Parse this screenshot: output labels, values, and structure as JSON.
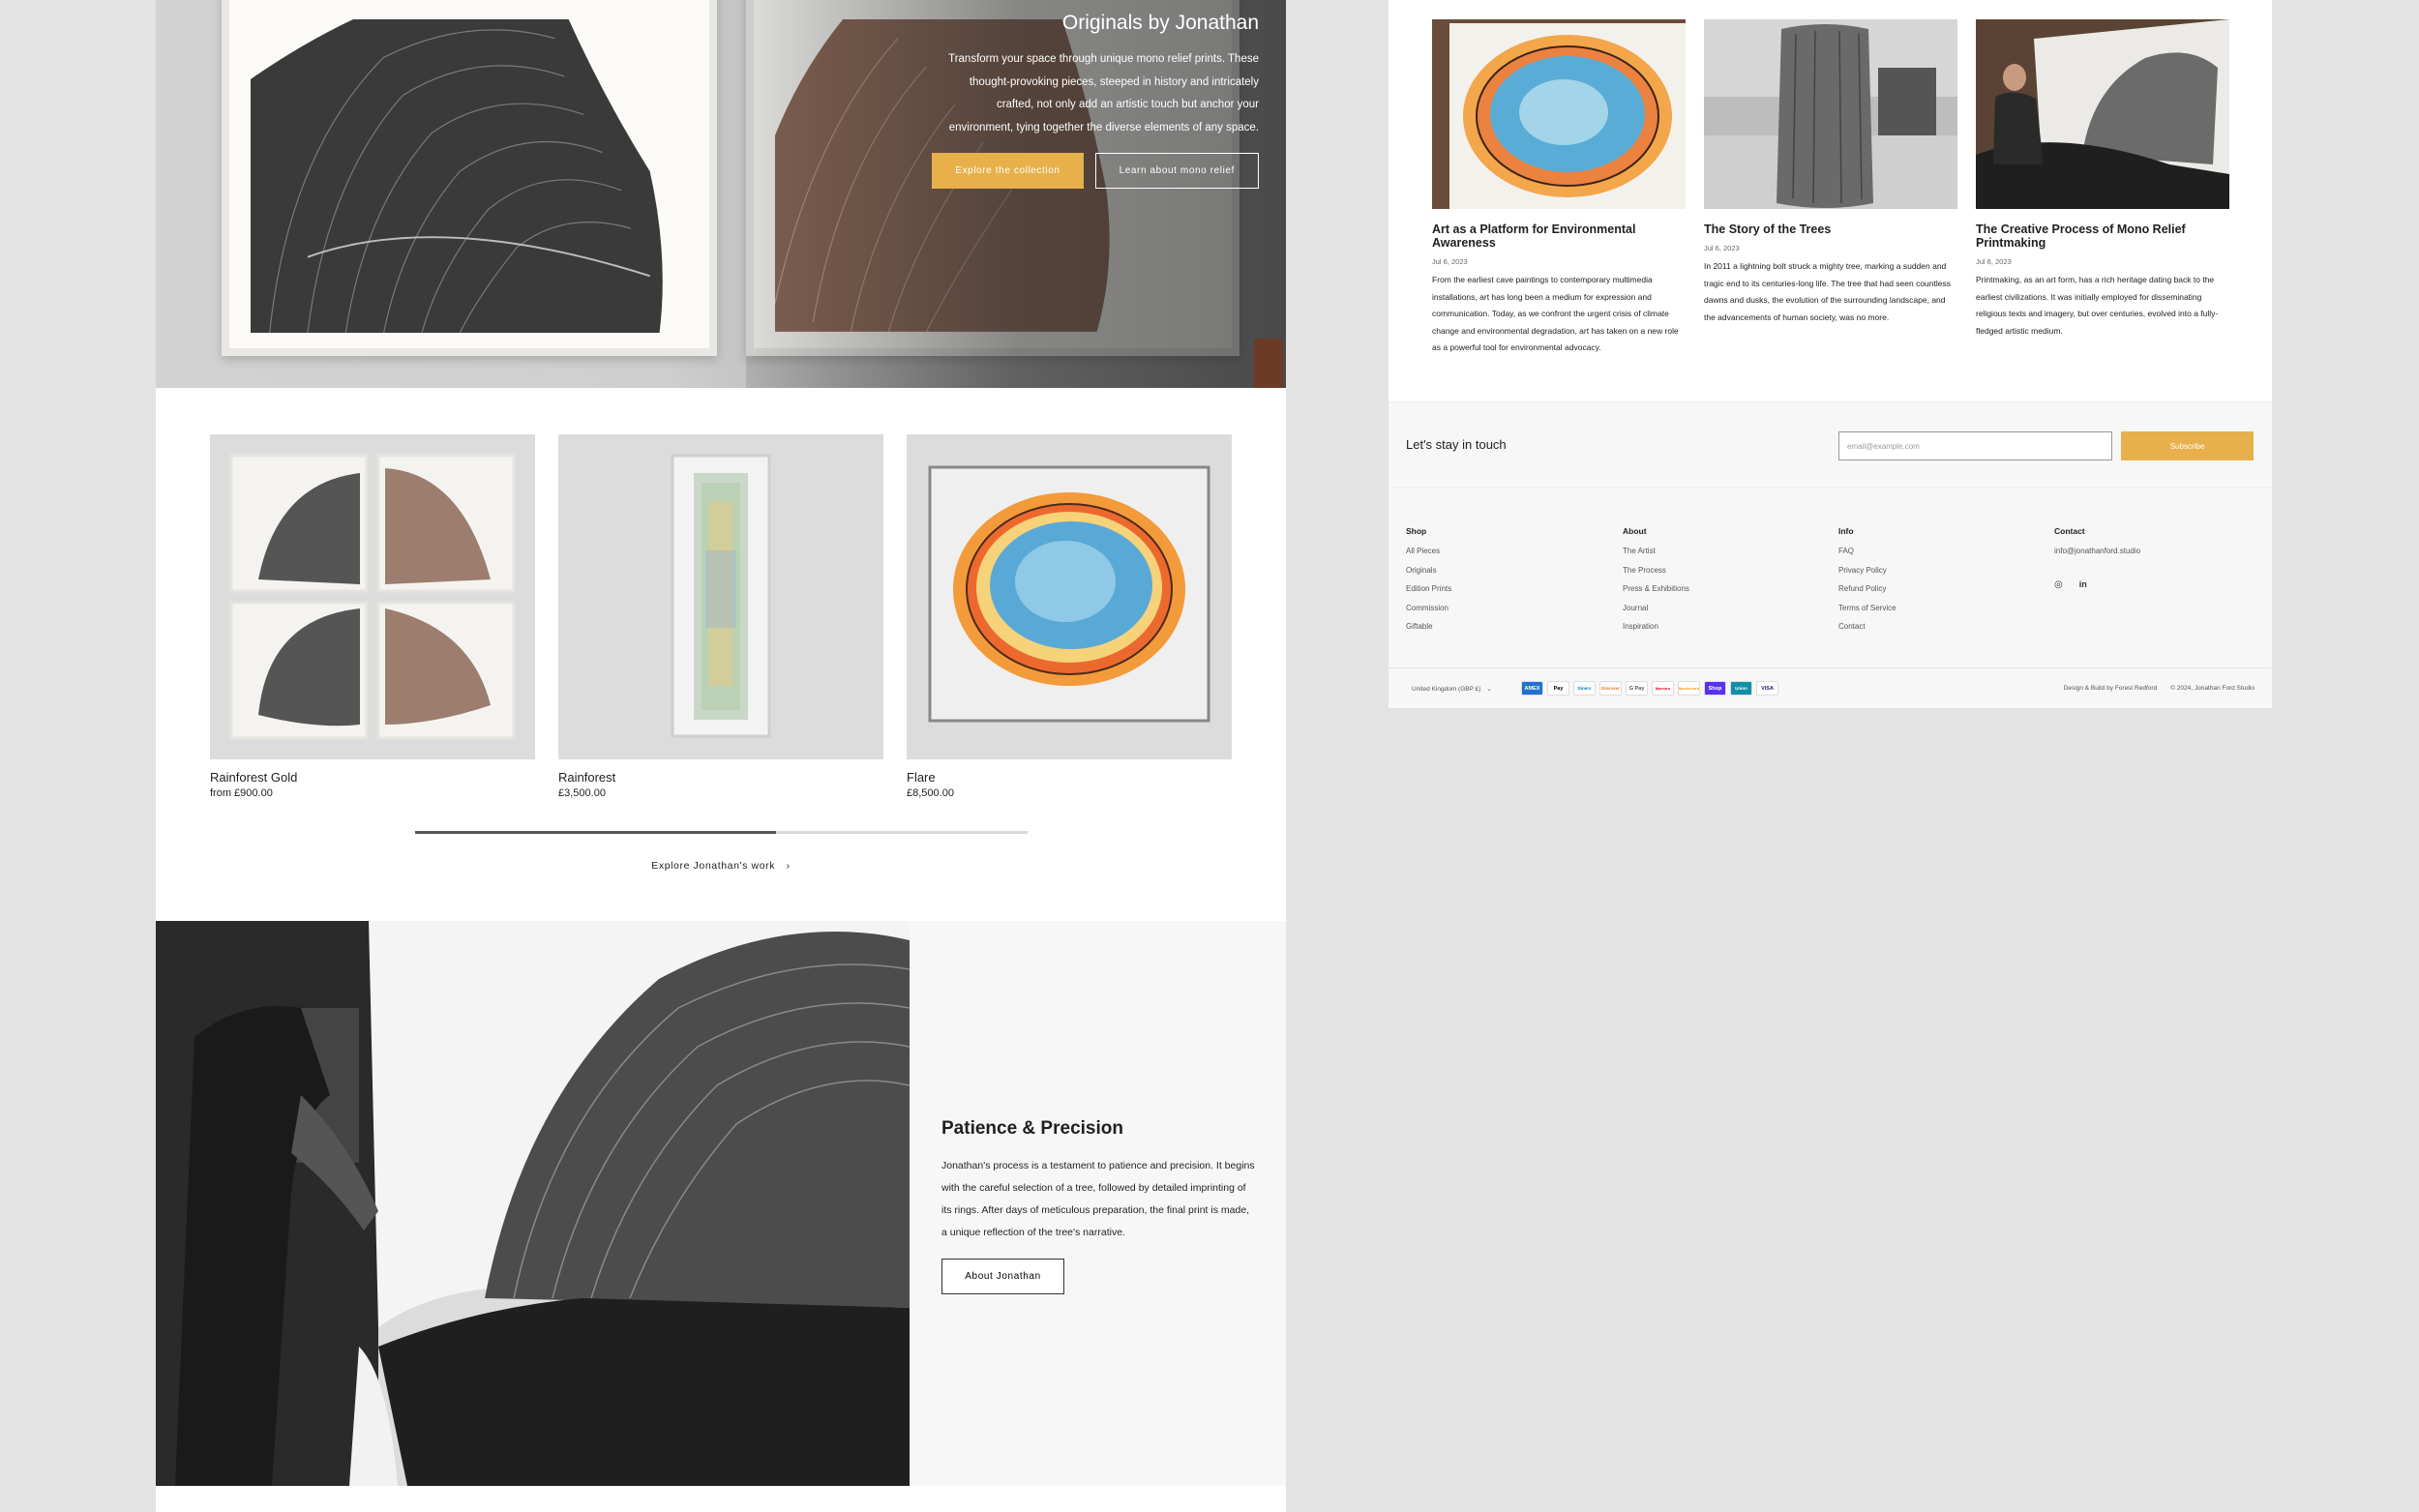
{
  "hero": {
    "title": "Originals by Jonathan",
    "text": "Transform your space through unique mono relief prints. These thought-provoking pieces, steeped in history and intricately crafted, not only add an artistic touch but anchor your environment, tying together the diverse elements of any space.",
    "primary_button": "Explore the collection",
    "secondary_button": "Learn about mono relief"
  },
  "products": [
    {
      "name": "Rainforest Gold",
      "price": "from £900.00"
    },
    {
      "name": "Rainforest",
      "price": "£3,500.00"
    },
    {
      "name": "Flare",
      "price": "£8,500.00"
    }
  ],
  "carousel": {
    "progress": 0.59
  },
  "explore_link": "Explore Jonathan's work",
  "process": {
    "title": "Patience & Precision",
    "text": "Jonathan's process is a testament to patience and precision. It begins with the careful selection of a tree, followed by detailed imprinting of its rings. After days of meticulous preparation, the final print is made, a unique reflection of the tree's narrative.",
    "button": "About Jonathan"
  },
  "articles": [
    {
      "title": "Art as a Platform for Environmental Awareness",
      "date": "Jul 6, 2023",
      "excerpt": "From the earliest cave paintings to contemporary multimedia installations, art has long been a medium for expression and communication. Today, as we confront the urgent crisis of climate change and environmental degradation, art has taken on a new role as a powerful tool for environmental advocacy."
    },
    {
      "title": "The Story of the Trees",
      "date": "Jul 6, 2023",
      "excerpt": "In 2011 a lightning bolt struck a mighty tree, marking a sudden and tragic end to its centuries-long life. The tree that had seen countless dawns and dusks, the evolution of the surrounding landscape, and the advancements of human society, was no more."
    },
    {
      "title": "The Creative Process of Mono Relief Printmaking",
      "date": "Jul 6, 2023",
      "excerpt": "Printmaking, as an art form, has a rich heritage dating back to the earliest civilizations. It was initially employed for disseminating religious texts and imagery, but over centuries, evolved into a fully-fledged artistic medium."
    }
  ],
  "newsletter": {
    "title": "Let's stay in touch",
    "placeholder": "email@example.com",
    "button": "Subscribe"
  },
  "footer": {
    "shop": {
      "heading": "Shop",
      "items": [
        "All Pieces",
        "Originals",
        "Edition Prints",
        "Commission",
        "Giftable"
      ]
    },
    "about": {
      "heading": "About",
      "items": [
        "The Artist",
        "The Process",
        "Press & Exhibitions",
        "Journal",
        "Inspiration"
      ]
    },
    "info": {
      "heading": "Info",
      "items": [
        "FAQ",
        "Privacy Policy",
        "Refund Policy",
        "Terms of Service",
        "Contact"
      ]
    },
    "contact": {
      "heading": "Contact",
      "email": "info@jonathanford.studio",
      "social_instagram": "instagram-icon",
      "social_linkedin": "in"
    },
    "locale": "United Kingdom (GBP £)",
    "payment_methods": [
      "AMEX",
      "Pay",
      "Diners",
      "Discover",
      "G Pay",
      "Maestro",
      "Mastercard",
      "Shop",
      "Union",
      "VISA"
    ],
    "credit_design": "Design & Build by Forest Redford",
    "copyright": "© 2024, Jonathan Ford Studio"
  },
  "colors": {
    "accent": "#e8b04a",
    "page_bg": "#e3e3e3",
    "footer_bg": "#f7f7f7"
  }
}
